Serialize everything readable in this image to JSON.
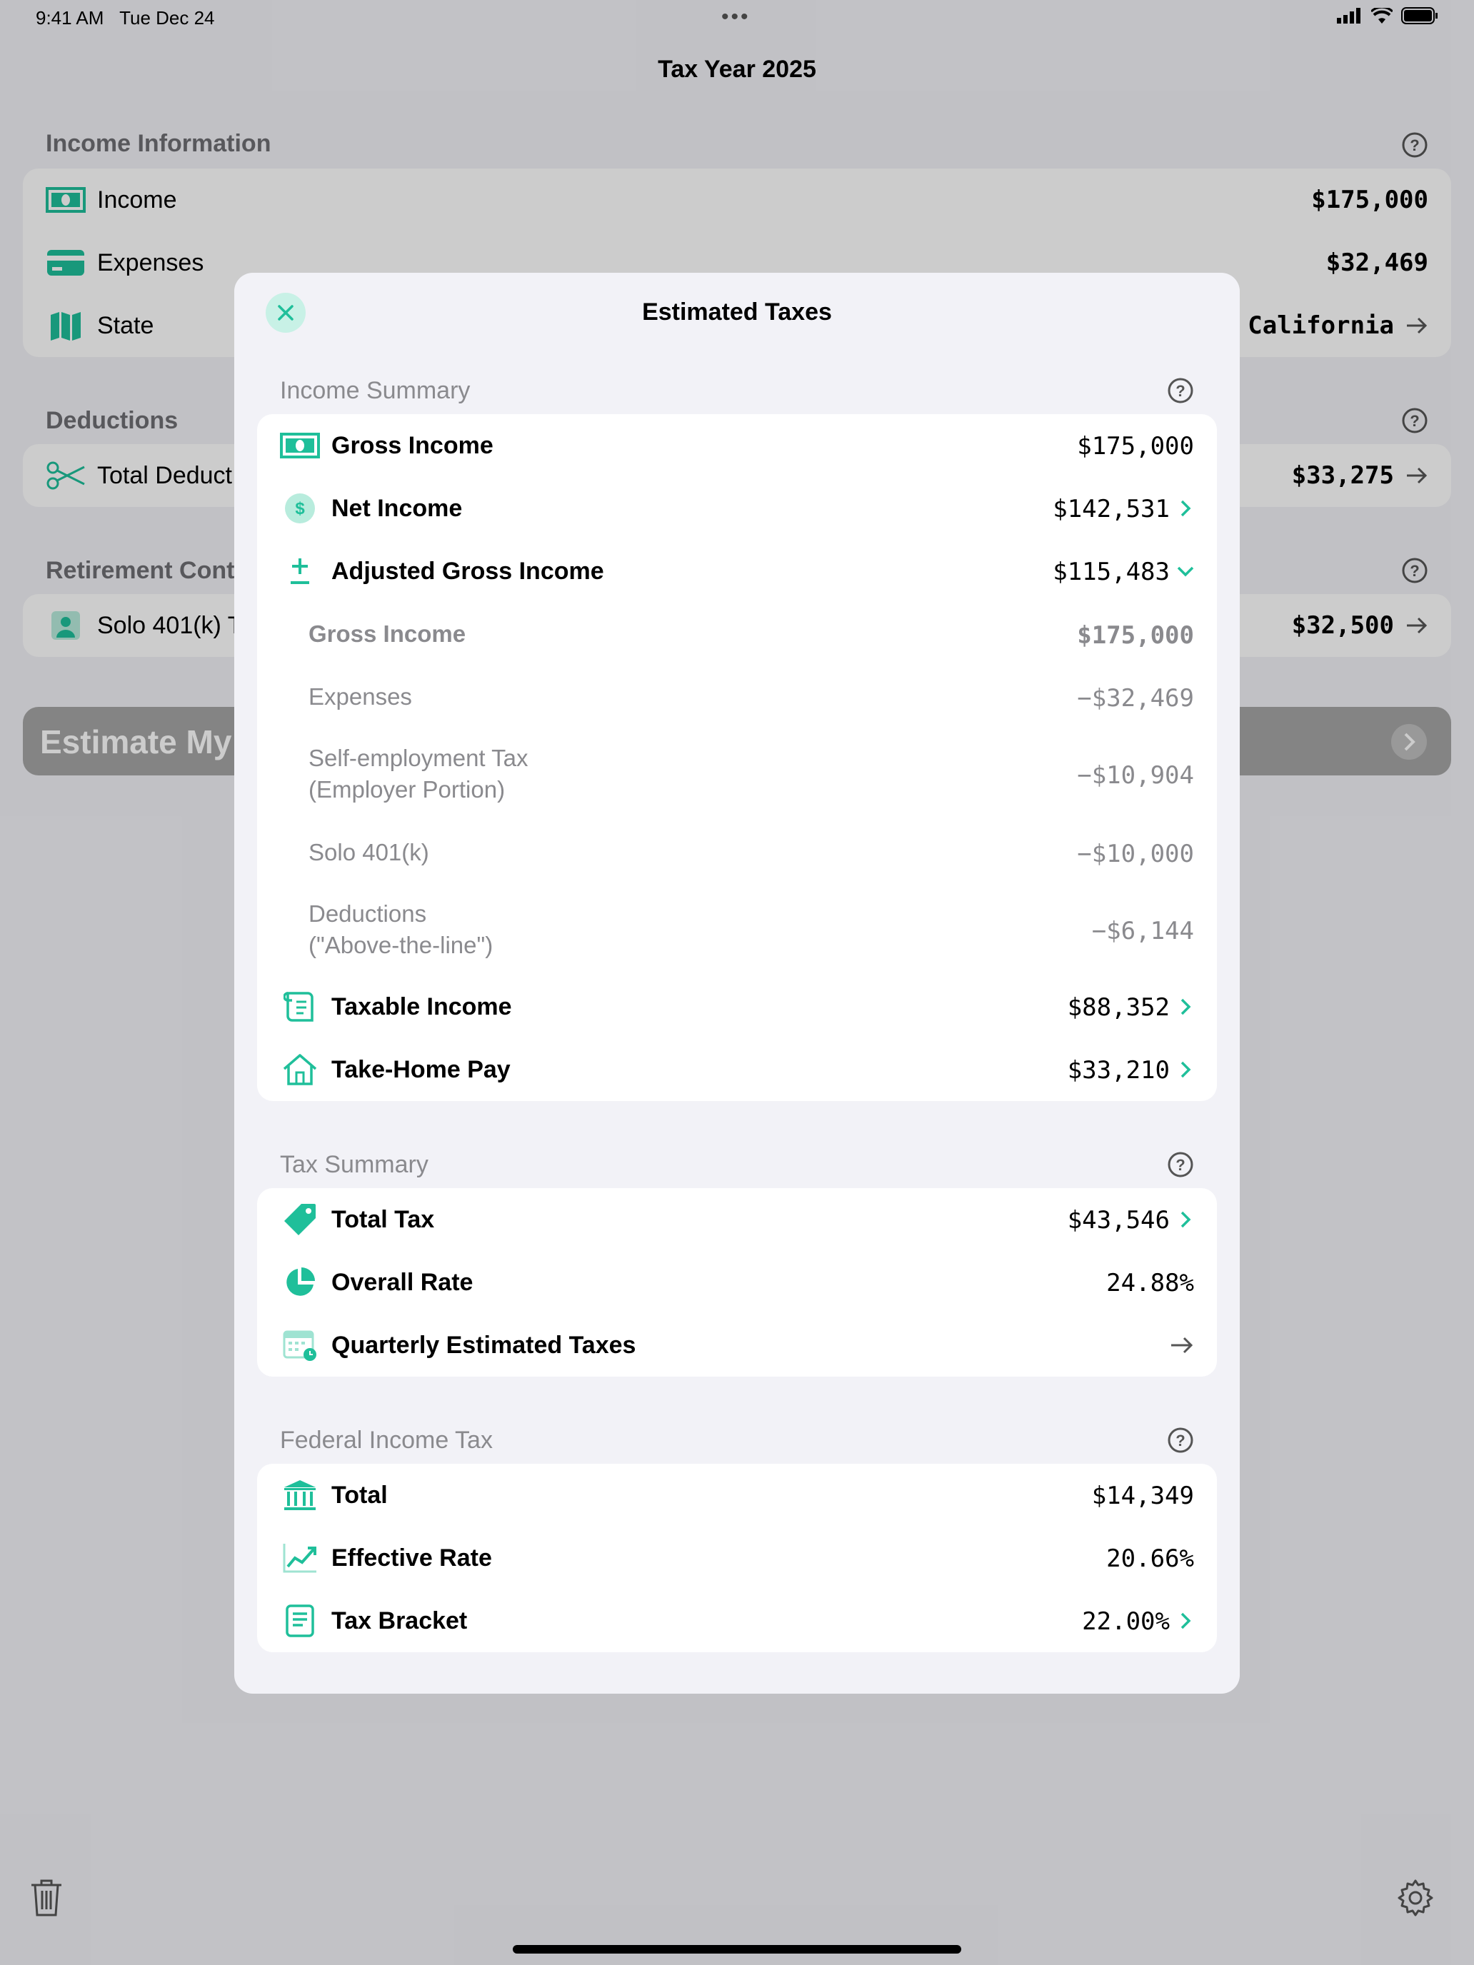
{
  "status_bar": {
    "time": "9:41 AM",
    "date": "Tue Dec 24"
  },
  "background": {
    "nav_title": "Tax Year 2025",
    "income_section": {
      "title": "Income Information",
      "rows": [
        {
          "label": "Income",
          "value": "$175,000"
        },
        {
          "label": "Expenses",
          "value": "$32,469"
        },
        {
          "label": "State",
          "value": "California"
        }
      ]
    },
    "deductions_section": {
      "title": "Deductions",
      "rows": [
        {
          "label": "Total Deduct",
          "value": "$33,275"
        }
      ]
    },
    "retirement_section": {
      "title": "Retirement Contr",
      "rows": [
        {
          "label": "Solo 401(k) T",
          "value": "$32,500"
        }
      ]
    },
    "estimate_button": "Estimate My T"
  },
  "sheet": {
    "title": "Estimated Taxes",
    "income_summary": {
      "title": "Income Summary",
      "rows": [
        {
          "label": "Gross Income",
          "value": "$175,000"
        },
        {
          "label": "Net Income",
          "value": "$142,531"
        },
        {
          "label": "Adjusted Gross Income",
          "value": "$115,483"
        }
      ],
      "breakdown": [
        {
          "label": "Gross Income",
          "value": "$175,000"
        },
        {
          "label": "Expenses",
          "value": "−$32,469"
        },
        {
          "label_line1": "Self-employment Tax",
          "label_line2": "(Employer Portion)",
          "value": "−$10,904"
        },
        {
          "label": "Solo 401(k)",
          "value": "−$10,000"
        },
        {
          "label_line1": "Deductions",
          "label_line2": "(\"Above-the-line\")",
          "value": "−$6,144"
        }
      ],
      "rows_after": [
        {
          "label": "Taxable Income",
          "value": "$88,352"
        },
        {
          "label": "Take-Home Pay",
          "value": "$33,210"
        }
      ]
    },
    "tax_summary": {
      "title": "Tax Summary",
      "rows": [
        {
          "label": "Total Tax",
          "value": "$43,546"
        },
        {
          "label": "Overall Rate",
          "value": "24.88%"
        },
        {
          "label": "Quarterly Estimated Taxes",
          "value": ""
        }
      ]
    },
    "federal_income_tax": {
      "title": "Federal Income Tax",
      "rows": [
        {
          "label": "Total",
          "value": "$14,349"
        },
        {
          "label": "Effective Rate",
          "value": "20.66%"
        },
        {
          "label": "Tax Bracket",
          "value": "22.00%"
        }
      ]
    }
  },
  "colors": {
    "accent": "#1fbf9a",
    "secondary_text": "#8a8a8e"
  },
  "icons": [
    "money-icon",
    "card-icon",
    "map-icon",
    "scissors-icon",
    "person-icon",
    "dollar-icon",
    "plus-minus-icon",
    "scroll-icon",
    "house-icon",
    "tag-icon",
    "pie-icon",
    "calendar-icon",
    "bank-icon",
    "chart-icon",
    "document-icon",
    "trash-icon",
    "gear-icon",
    "question-icon",
    "close-icon"
  ]
}
